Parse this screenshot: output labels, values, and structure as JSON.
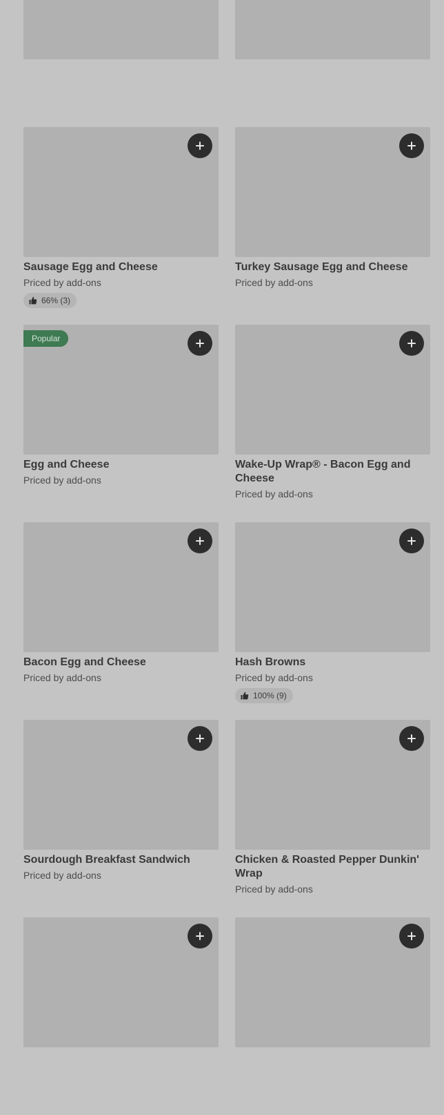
{
  "accent": {
    "popular_green": "#3e7a52",
    "button_dark": "#2d2d2d"
  },
  "items": [
    {
      "name": "",
      "price": "",
      "rating": "",
      "popular": false
    },
    {
      "name": "",
      "price": "",
      "rating": "",
      "popular": false
    },
    {
      "name": "Sausage Egg and Cheese",
      "price": "Priced by add-ons",
      "rating": "66% (3)",
      "popular": false
    },
    {
      "name": "Turkey Sausage Egg and Cheese",
      "price": "Priced by add-ons",
      "rating": "",
      "popular": false
    },
    {
      "name": "Egg and Cheese",
      "price": "Priced by add-ons",
      "rating": "",
      "popular": true,
      "popular_label": "Popular"
    },
    {
      "name": "Wake-Up Wrap® - Bacon Egg and Cheese",
      "price": "Priced by add-ons",
      "rating": "",
      "popular": false
    },
    {
      "name": "Bacon Egg and Cheese",
      "price": "Priced by add-ons",
      "rating": "",
      "popular": false
    },
    {
      "name": "Hash Browns",
      "price": "Priced by add-ons",
      "rating": "100% (9)",
      "popular": false
    },
    {
      "name": "Sourdough Breakfast Sandwich",
      "price": "Priced by add-ons",
      "rating": "",
      "popular": false
    },
    {
      "name": "Chicken & Roasted Pepper Dunkin' Wrap",
      "price": "Priced by add-ons",
      "rating": "",
      "popular": false
    },
    {
      "name": "",
      "price": "",
      "rating": "",
      "popular": false
    },
    {
      "name": "",
      "price": "",
      "rating": "",
      "popular": false
    }
  ]
}
